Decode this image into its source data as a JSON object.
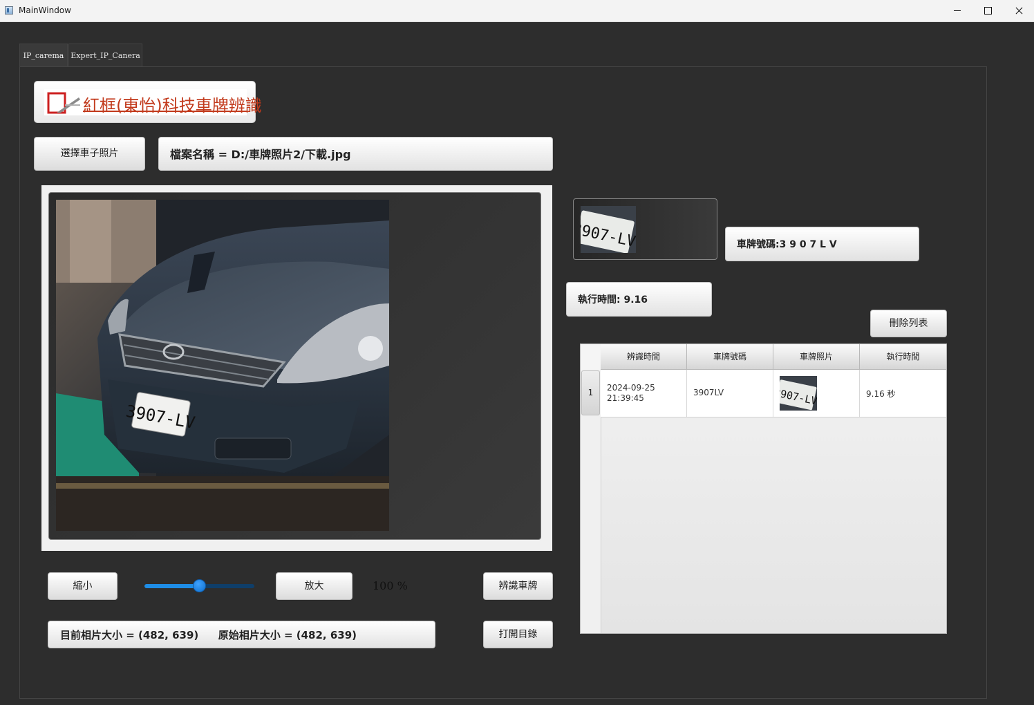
{
  "window": {
    "title": "MainWindow"
  },
  "tabs": [
    {
      "label": "IP_carema",
      "active": true
    },
    {
      "label": "Expert_IP_Canera",
      "active": false
    }
  ],
  "logo": {
    "text": "紅框(東怡)科技車牌辨識"
  },
  "buttons": {
    "select_photo": "選擇車子照片",
    "zoom_out": "縮小",
    "zoom_in": "放大",
    "recognize": "辨識車牌",
    "open_dir": "打開目錄",
    "clear_list": "刪除列表"
  },
  "file": {
    "label": "檔案名稱 = D:/車牌照片2/下載.jpg"
  },
  "result": {
    "plate_label": "車牌號碼:3 9 0 7 L V",
    "exec_time_label": "執行時間: 9.16"
  },
  "zoom": {
    "percent_label": "100 %",
    "slider_value": 0.5
  },
  "size_info": {
    "current": "目前相片大小 = (482, 639)",
    "original": "原始相片大小 = (482, 639)"
  },
  "table": {
    "columns": [
      "辨識時間",
      "車牌號碼",
      "車牌照片",
      "執行時間"
    ],
    "rows": [
      {
        "index": "1",
        "date": "2024-09-25",
        "time": "21:39:45",
        "plate": "3907LV",
        "exec": "9.16 秒"
      }
    ]
  },
  "plate_text_on_image": "3907-LV",
  "colors": {
    "background": "#2d2d2d",
    "accent": "#1e8de6",
    "logo_red": "#c23a1c"
  }
}
